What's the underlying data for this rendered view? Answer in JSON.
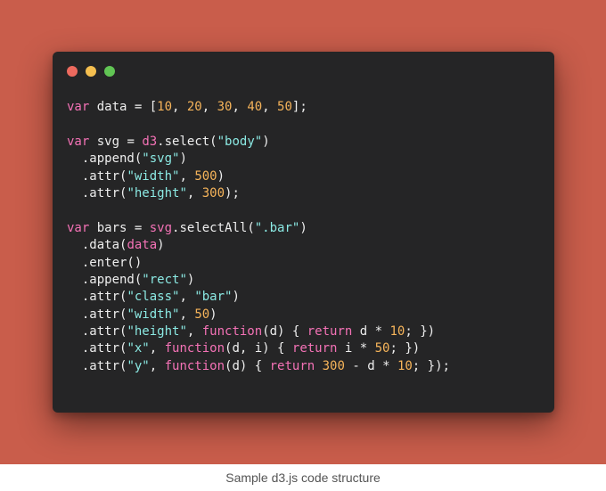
{
  "window": {
    "controls": [
      {
        "name": "close-control",
        "color": "#ed6a5e"
      },
      {
        "name": "minimize-control",
        "color": "#f5bf4f"
      },
      {
        "name": "maximize-control",
        "color": "#61c554"
      }
    ]
  },
  "colors": {
    "background": "#c95d4b",
    "panel": "#252526",
    "keyword": "#f472b6",
    "number": "#f6b45a",
    "string": "#8be9e3",
    "plain": "#eeeeee"
  },
  "code": {
    "lines": [
      [
        [
          "k",
          "var"
        ],
        [
          "p",
          " data = ["
        ],
        [
          "n",
          "10"
        ],
        [
          "p",
          ", "
        ],
        [
          "n",
          "20"
        ],
        [
          "p",
          ", "
        ],
        [
          "n",
          "30"
        ],
        [
          "p",
          ", "
        ],
        [
          "n",
          "40"
        ],
        [
          "p",
          ", "
        ],
        [
          "n",
          "50"
        ],
        [
          "p",
          "];"
        ]
      ],
      [],
      [
        [
          "k",
          "var"
        ],
        [
          "p",
          " svg = "
        ],
        [
          "k",
          "d3"
        ],
        [
          "p",
          ".select("
        ],
        [
          "s",
          "\"body\""
        ],
        [
          "p",
          ")"
        ]
      ],
      [
        [
          "p",
          "  .append("
        ],
        [
          "s",
          "\"svg\""
        ],
        [
          "p",
          ")"
        ]
      ],
      [
        [
          "p",
          "  .attr("
        ],
        [
          "s",
          "\"width\""
        ],
        [
          "p",
          ", "
        ],
        [
          "n",
          "500"
        ],
        [
          "p",
          ")"
        ]
      ],
      [
        [
          "p",
          "  .attr("
        ],
        [
          "s",
          "\"height\""
        ],
        [
          "p",
          ", "
        ],
        [
          "n",
          "300"
        ],
        [
          "p",
          ");"
        ]
      ],
      [],
      [
        [
          "k",
          "var"
        ],
        [
          "p",
          " bars = "
        ],
        [
          "k",
          "svg"
        ],
        [
          "p",
          ".selectAll("
        ],
        [
          "s",
          "\".bar\""
        ],
        [
          "p",
          ")"
        ]
      ],
      [
        [
          "p",
          "  .data("
        ],
        [
          "k",
          "data"
        ],
        [
          "p",
          ")"
        ]
      ],
      [
        [
          "p",
          "  .enter()"
        ]
      ],
      [
        [
          "p",
          "  .append("
        ],
        [
          "s",
          "\"rect\""
        ],
        [
          "p",
          ")"
        ]
      ],
      [
        [
          "p",
          "  .attr("
        ],
        [
          "s",
          "\"class\""
        ],
        [
          "p",
          ", "
        ],
        [
          "s",
          "\"bar\""
        ],
        [
          "p",
          ")"
        ]
      ],
      [
        [
          "p",
          "  .attr("
        ],
        [
          "s",
          "\"width\""
        ],
        [
          "p",
          ", "
        ],
        [
          "n",
          "50"
        ],
        [
          "p",
          ")"
        ]
      ],
      [
        [
          "p",
          "  .attr("
        ],
        [
          "s",
          "\"height\""
        ],
        [
          "p",
          ", "
        ],
        [
          "k",
          "function"
        ],
        [
          "p",
          "(d) { "
        ],
        [
          "k",
          "return"
        ],
        [
          "p",
          " d * "
        ],
        [
          "n",
          "10"
        ],
        [
          "p",
          "; })"
        ]
      ],
      [
        [
          "p",
          "  .attr("
        ],
        [
          "s",
          "\"x\""
        ],
        [
          "p",
          ", "
        ],
        [
          "k",
          "function"
        ],
        [
          "p",
          "(d, i) { "
        ],
        [
          "k",
          "return"
        ],
        [
          "p",
          " i * "
        ],
        [
          "n",
          "50"
        ],
        [
          "p",
          "; })"
        ]
      ],
      [
        [
          "p",
          "  .attr("
        ],
        [
          "s",
          "\"y\""
        ],
        [
          "p",
          ", "
        ],
        [
          "k",
          "function"
        ],
        [
          "p",
          "(d) { "
        ],
        [
          "k",
          "return"
        ],
        [
          "p",
          " "
        ],
        [
          "n",
          "300"
        ],
        [
          "p",
          " - d * "
        ],
        [
          "n",
          "10"
        ],
        [
          "p",
          "; });"
        ]
      ]
    ]
  },
  "caption": "Sample d3.js code structure"
}
